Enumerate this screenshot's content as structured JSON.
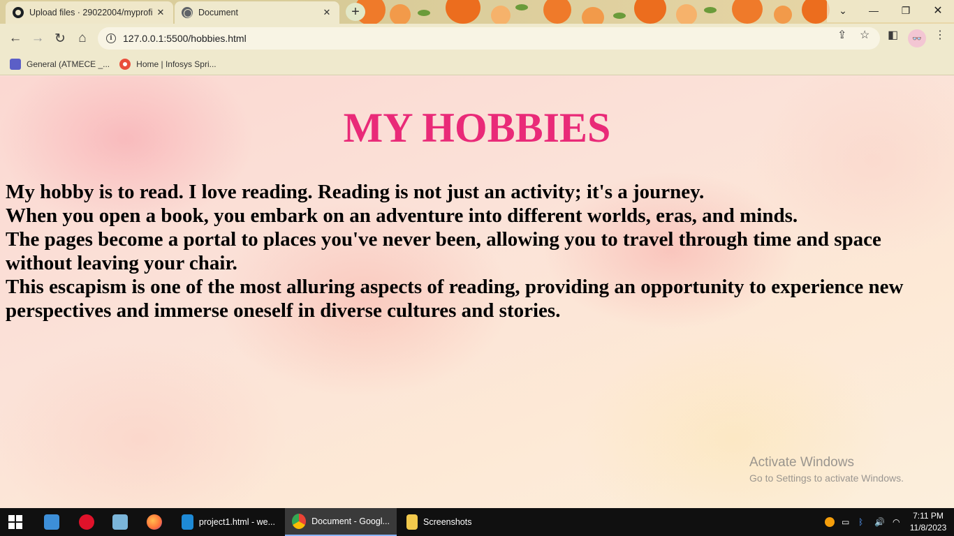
{
  "browser": {
    "tabs": [
      {
        "title": "Upload files · 29022004/myprofi",
        "icon": "github-icon",
        "active": false
      },
      {
        "title": "Document",
        "icon": "globe-icon",
        "active": true
      }
    ],
    "url": "127.0.0.1:5500/hobbies.html",
    "bookmarks": [
      {
        "label": "General (ATMECE _...",
        "icon": "teams-icon"
      },
      {
        "label": "Home | Infosys Spri...",
        "icon": "infosys-icon"
      }
    ]
  },
  "page": {
    "title": "MY HOBBIES",
    "paragraph_lines": [
      "My hobby is to read. I love reading. Reading is not just an activity; it's a journey.",
      "When you open a book, you embark on an adventure into different worlds, eras, and minds.",
      "The pages become a portal to places you've never been, allowing you to travel through time and space without leaving your chair.",
      "This escapism is one of the most alluring aspects of reading, providing an opportunity to experience new perspectives and immerse oneself in diverse cultures and stories."
    ],
    "title_color": "#e92a78"
  },
  "watermark": {
    "line1": "Activate Windows",
    "line2": "Go to Settings to activate Windows."
  },
  "taskbar": {
    "apps": [
      {
        "label": "project1.html - we...",
        "icon": "vscode-icon"
      },
      {
        "label": "Document - Googl...",
        "icon": "chrome-icon"
      },
      {
        "label": "Screenshots",
        "icon": "folder-icon"
      }
    ],
    "time": "7:11 PM",
    "date": "11/8/2023"
  }
}
